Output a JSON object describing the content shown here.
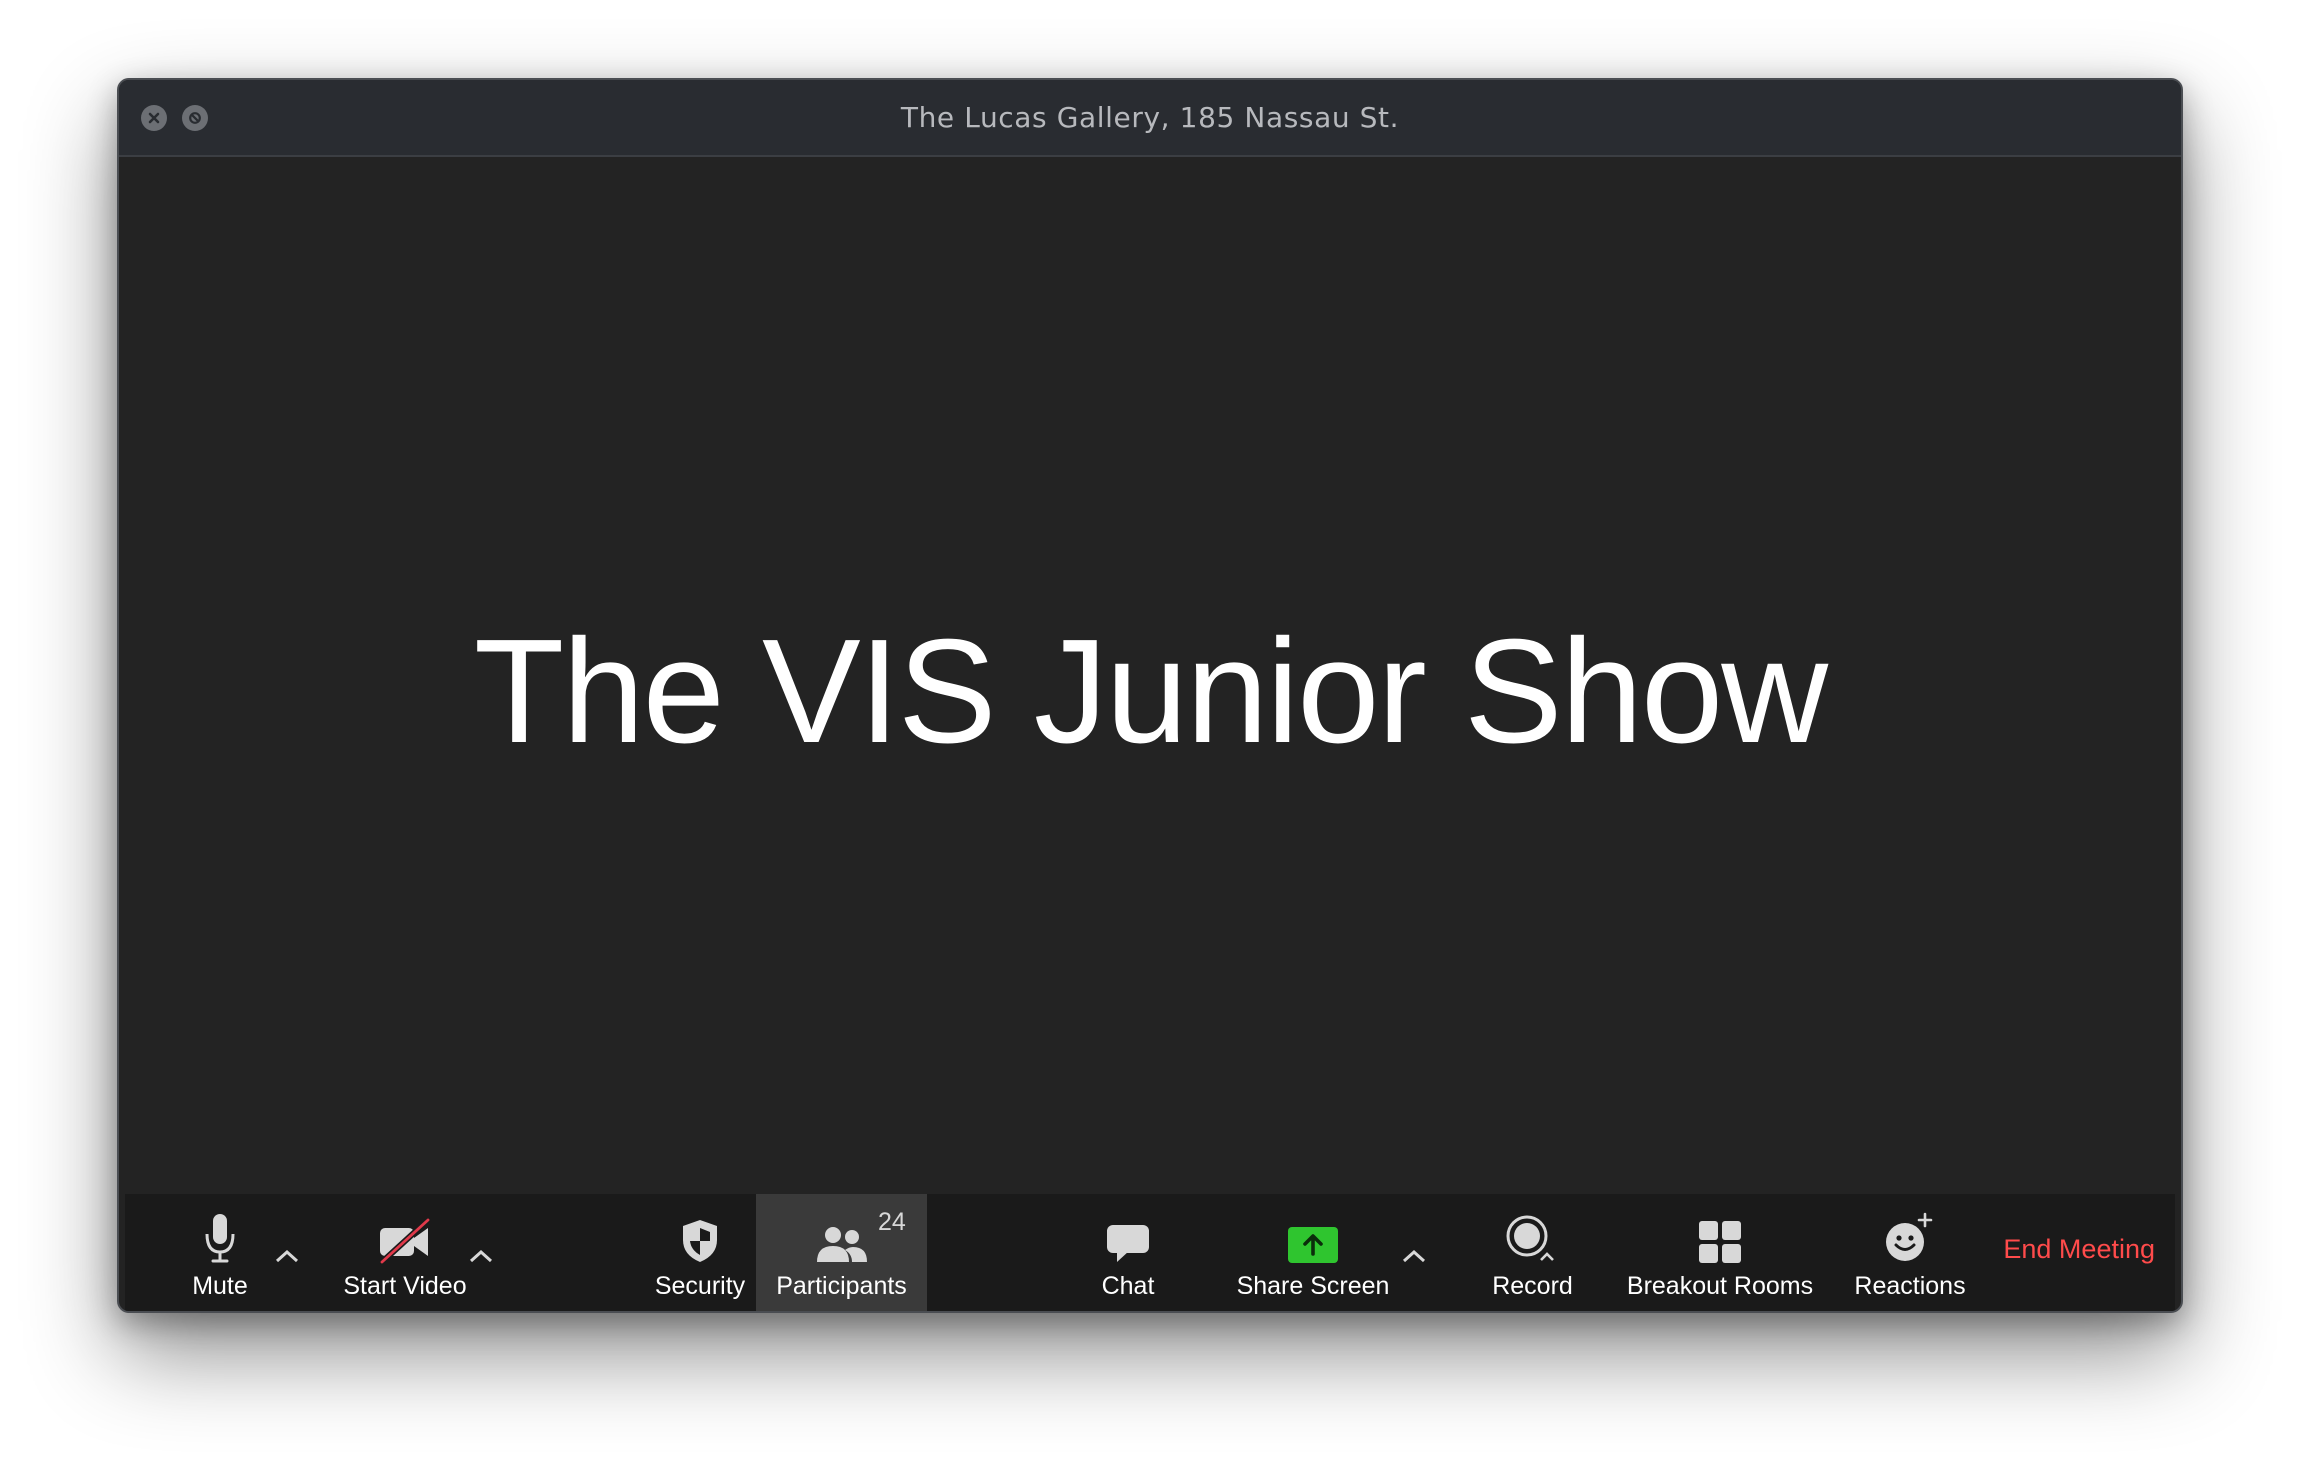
{
  "window": {
    "title": "The Lucas Gallery, 185 Nassau St."
  },
  "main": {
    "show_title": "The VIS Junior Show"
  },
  "toolbar": {
    "mute_label": "Mute",
    "start_video_label": "Start Video",
    "security_label": "Security",
    "participants_label": "Participants",
    "participants_count": "24",
    "chat_label": "Chat",
    "share_screen_label": "Share Screen",
    "record_label": "Record",
    "breakout_rooms_label": "Breakout Rooms",
    "reactions_label": "Reactions",
    "end_meeting_label": "End Meeting"
  },
  "icons": {
    "close": "close-icon",
    "minimize": "minimize-icon",
    "mute": "microphone-icon",
    "video": "video-off-icon",
    "security": "shield-icon",
    "participants": "people-icon",
    "chat": "chat-bubble-icon",
    "share": "share-screen-icon",
    "record": "record-icon",
    "breakout": "grid-icon",
    "reactions": "smiley-icon"
  },
  "colors": {
    "share_screen_green": "#2fc52f",
    "end_meeting_red": "#ff4b4b",
    "video_off_slash": "#e0394a"
  }
}
